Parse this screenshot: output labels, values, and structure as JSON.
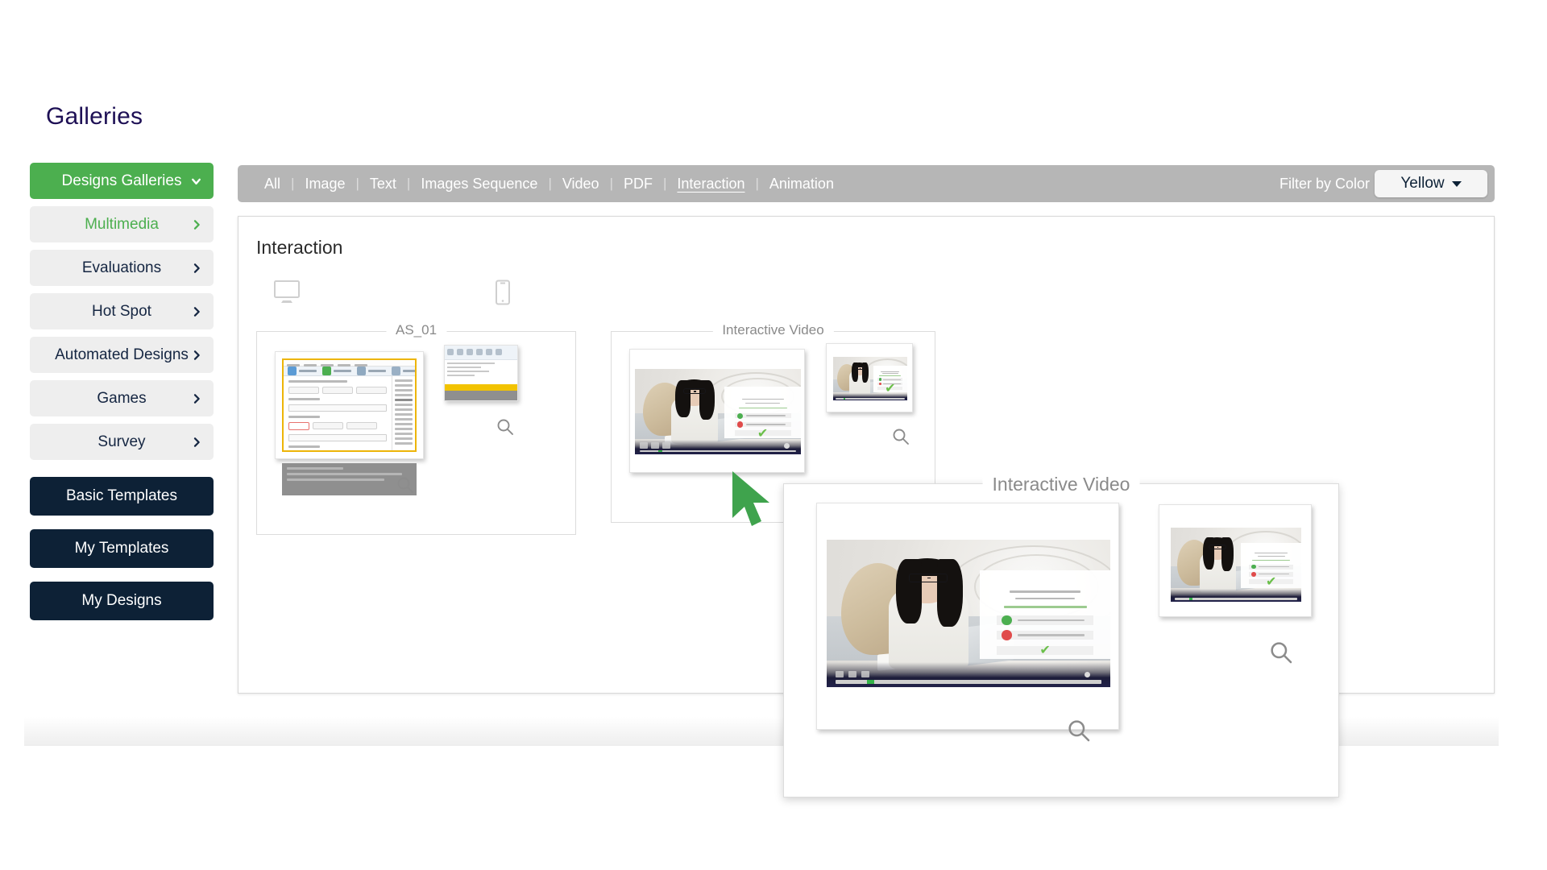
{
  "page": {
    "title": "Galleries"
  },
  "sidebar": {
    "nav_items": [
      {
        "label": "Designs Galleries",
        "icon": "chevron-down-icon",
        "state": "expanded",
        "style": "primary"
      },
      {
        "label": "Multimedia",
        "icon": "chevron-right-icon",
        "state": "active",
        "style": "plain"
      },
      {
        "label": "Evaluations",
        "icon": "chevron-right-icon",
        "state": "default",
        "style": "plain"
      },
      {
        "label": "Hot Spot",
        "icon": "chevron-right-icon",
        "state": "default",
        "style": "plain"
      },
      {
        "label": "Automated Designs",
        "icon": "chevron-right-icon",
        "state": "default",
        "style": "plain"
      },
      {
        "label": "Games",
        "icon": "chevron-right-icon",
        "state": "default",
        "style": "plain"
      },
      {
        "label": "Survey",
        "icon": "chevron-right-icon",
        "state": "default",
        "style": "plain"
      }
    ],
    "action_items": [
      {
        "label": "Basic Templates"
      },
      {
        "label": "My Templates"
      },
      {
        "label": "My Designs"
      }
    ]
  },
  "filter_bar": {
    "tabs": [
      {
        "label": "All",
        "selected": false
      },
      {
        "label": "Image",
        "selected": false
      },
      {
        "label": "Text",
        "selected": false
      },
      {
        "label": "Images Sequence",
        "selected": false
      },
      {
        "label": "Video",
        "selected": false
      },
      {
        "label": "PDF",
        "selected": false
      },
      {
        "label": "Interaction",
        "selected": true
      },
      {
        "label": "Animation",
        "selected": false
      }
    ],
    "separator": "|",
    "color_filter_label": "Filter by Color",
    "color_filter_value": "Yellow",
    "color_filter_caret": "caret-down-icon"
  },
  "content": {
    "heading": "Interaction",
    "device_icons": [
      {
        "name": "desktop-icon"
      },
      {
        "name": "mobile-icon"
      }
    ],
    "cards": [
      {
        "legend": "AS_01",
        "zoom_icon": "magnifier-icon",
        "secondary_zoom_icon": "magnifier-icon"
      },
      {
        "legend": "Interactive Video",
        "zoom_icon": "magnifier-icon",
        "secondary_zoom_icon": "magnifier-icon"
      }
    ]
  },
  "popup": {
    "legend": "Interactive Video",
    "zoom_icon": "magnifier-icon",
    "secondary_zoom_icon": "magnifier-icon"
  },
  "cursor": {
    "name": "mouse-pointer",
    "color": "#3fa34d"
  },
  "colors": {
    "title": "#1e1055",
    "primary_green": "#4caf4f",
    "dark_navy": "#0d2136",
    "filter_bar_gray": "#b6b6b6",
    "accent_yellow": "#f2c300"
  }
}
